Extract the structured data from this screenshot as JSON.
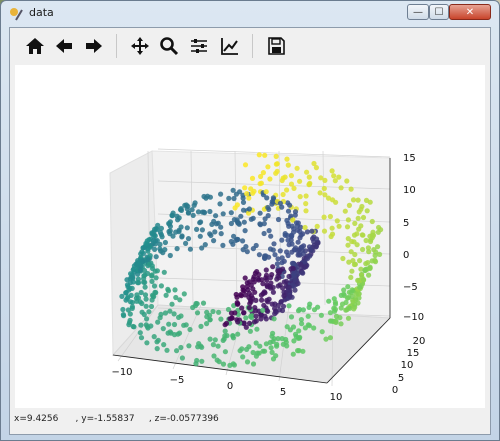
{
  "window": {
    "title": "data",
    "minimize_glyph": "—",
    "maximize_glyph": "☐",
    "close_glyph": "✕"
  },
  "toolbar": {
    "buttons": [
      {
        "name": "home-icon",
        "tooltip": "Home"
      },
      {
        "name": "back-arrow-icon",
        "tooltip": "Back"
      },
      {
        "name": "forward-arrow-icon",
        "tooltip": "Forward"
      },
      {
        "name": "pan-icon",
        "tooltip": "Pan"
      },
      {
        "name": "zoom-icon",
        "tooltip": "Zoom"
      },
      {
        "name": "subplots-icon",
        "tooltip": "Subplots"
      },
      {
        "name": "edit-axis-icon",
        "tooltip": "Customize"
      },
      {
        "name": "save-icon",
        "tooltip": "Save"
      }
    ]
  },
  "status": {
    "coords": "x=9.4256      , y=-1.55837     , z=-0.0577396"
  },
  "chart_data": {
    "type": "scatter",
    "dimension": "3d",
    "colormap": "viridis",
    "description_free": true,
    "x_ticks": [
      "−10",
      "−5",
      "0",
      "5",
      "10"
    ],
    "y_ticks": [
      "0",
      "5",
      "10",
      "15",
      "20"
    ],
    "z_ticks": [
      "−10",
      "−5",
      "0",
      "5",
      "10",
      "15"
    ],
    "xlim": [
      -11,
      14
    ],
    "ylim": [
      0,
      21
    ],
    "zlim": [
      -12,
      15
    ],
    "grid": true,
    "shape": "swiss-roll spiral",
    "colors": [
      "#440154",
      "#3b528b",
      "#21908d",
      "#5dc962",
      "#fde725"
    ]
  }
}
